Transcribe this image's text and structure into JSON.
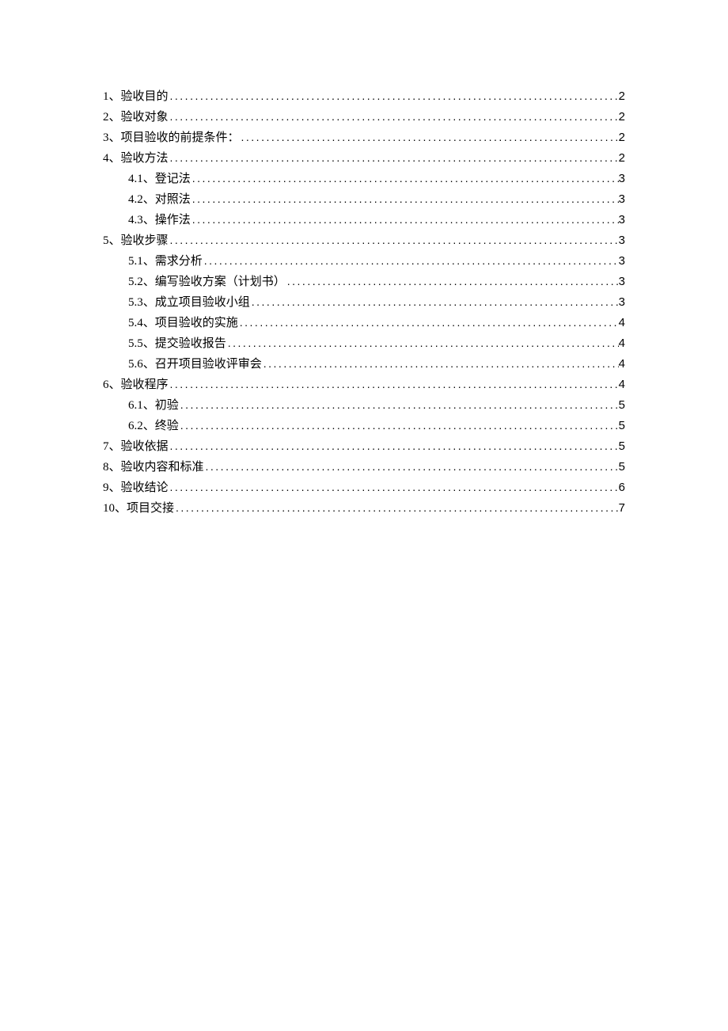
{
  "toc": [
    {
      "level": 1,
      "label": "1、验收目的",
      "page": "2"
    },
    {
      "level": 1,
      "label": "2、验收对象",
      "page": "2"
    },
    {
      "level": 1,
      "label": "3、项目验收的前提条件：",
      "page": "2"
    },
    {
      "level": 1,
      "label": "4、验收方法",
      "page": "2"
    },
    {
      "level": 2,
      "label": "4.1、登记法",
      "page": "3"
    },
    {
      "level": 2,
      "label": "4.2、对照法",
      "page": "3"
    },
    {
      "level": 2,
      "label": "4.3、操作法",
      "page": "3"
    },
    {
      "level": 1,
      "label": "5、验收步骤",
      "page": "3"
    },
    {
      "level": 2,
      "label": "5.1、需求分析",
      "page": "3"
    },
    {
      "level": 2,
      "label": "5.2、编写验收方案（计划书）",
      "page": "3"
    },
    {
      "level": 2,
      "label": "5.3、成立项目验收小组",
      "page": "3"
    },
    {
      "level": 2,
      "label": "5.4、项目验收的实施",
      "page": "4"
    },
    {
      "level": 2,
      "label": "5.5、提交验收报告",
      "page": "4"
    },
    {
      "level": 2,
      "label": "5.6、召开项目验收评审会",
      "page": "4"
    },
    {
      "level": 1,
      "label": "6、验收程序",
      "page": "4"
    },
    {
      "level": 2,
      "label": "6.1、初验",
      "page": "5"
    },
    {
      "level": 2,
      "label": "6.2、终验",
      "page": "5"
    },
    {
      "level": 1,
      "label": "7、验收依据",
      "page": "5"
    },
    {
      "level": 1,
      "label": "8、验收内容和标准",
      "page": "5"
    },
    {
      "level": 1,
      "label": "9、验收结论",
      "page": "6"
    },
    {
      "level": 1,
      "label": "10、项目交接",
      "page": "7"
    }
  ]
}
